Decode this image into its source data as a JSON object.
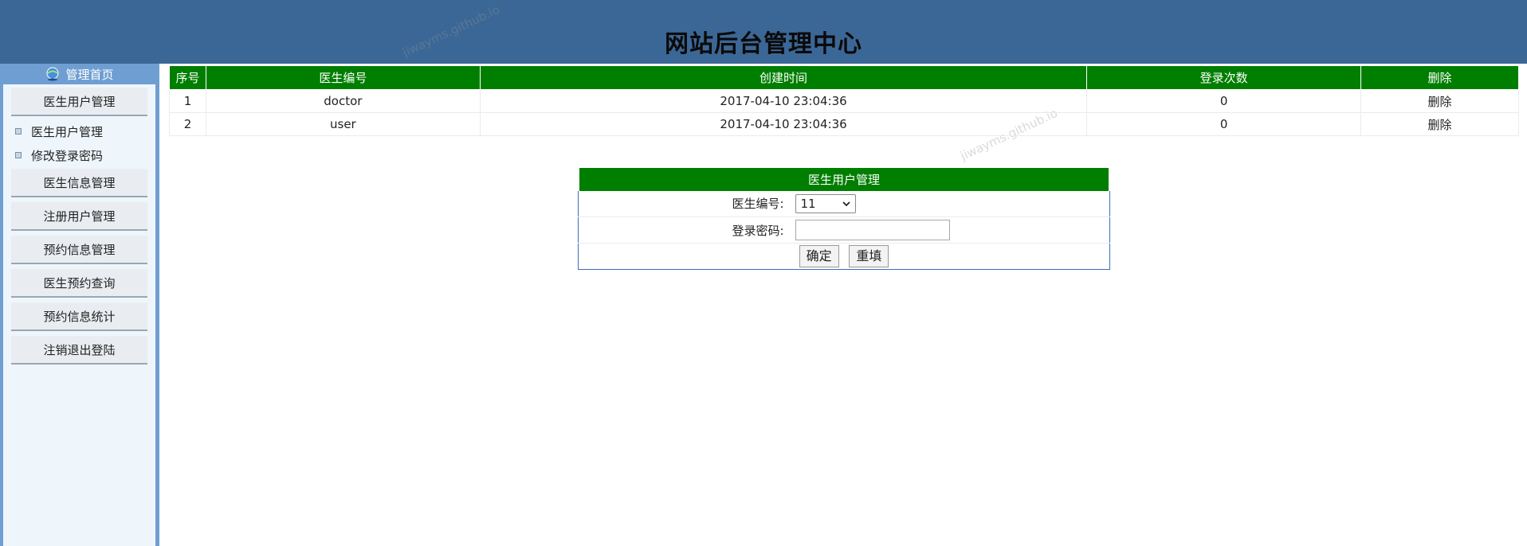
{
  "header": {
    "title": "网站后台管理中心"
  },
  "sidebar": {
    "home_label": "管理首页",
    "sections": [
      {
        "label": "医生用户管理",
        "items": [
          "医生用户管理",
          "修改登录密码"
        ]
      },
      {
        "label": "医生信息管理",
        "items": []
      },
      {
        "label": "注册用户管理",
        "items": []
      },
      {
        "label": "预约信息管理",
        "items": []
      },
      {
        "label": "医生预约查询",
        "items": []
      },
      {
        "label": "预约信息统计",
        "items": []
      },
      {
        "label": "注销退出登陆",
        "items": []
      }
    ]
  },
  "table": {
    "headers": [
      "序号",
      "医生编号",
      "创建时间",
      "登录次数",
      "删除"
    ],
    "rows": [
      [
        "1",
        "doctor",
        "2017-04-10 23:04:36",
        "0",
        "删除"
      ],
      [
        "2",
        "user",
        "2017-04-10 23:04:36",
        "0",
        "删除"
      ]
    ]
  },
  "form": {
    "title": "医生用户管理",
    "doctor_id_label": "医生编号:",
    "doctor_id_value": "11",
    "password_label": "登录密码:",
    "password_value": "",
    "confirm_label": "确定",
    "reset_label": "重填"
  },
  "watermarks": [
    "jiwayms.github.io",
    "jiwayms.github.io"
  ]
}
